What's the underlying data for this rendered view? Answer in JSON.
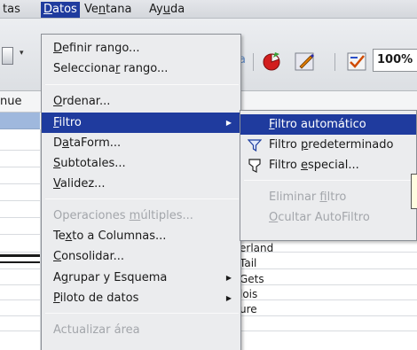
{
  "menubar": {
    "items": [
      {
        "label": "tas",
        "mnemonic": ""
      },
      {
        "label": "Datos",
        "mnemonic": "D"
      },
      {
        "label": "Ventana",
        "mnemonic": "n"
      },
      {
        "label": "Ayuda",
        "mnemonic": "u"
      }
    ],
    "active": "Datos"
  },
  "toolbar": {
    "zoom": "100%",
    "faint_text": "a"
  },
  "namebox": {
    "value": "nue"
  },
  "sheet": {
    "cells": [
      "erland",
      "Tail",
      "Gets",
      "lois",
      "ure"
    ]
  },
  "datos_menu": {
    "items": [
      {
        "label": "Definir rango...",
        "state": "normal"
      },
      {
        "label": "Seleccionar rango...",
        "state": "normal"
      },
      {
        "label": "Ordenar...",
        "state": "normal"
      },
      {
        "label": "Filtro",
        "state": "selected",
        "has_submenu": true
      },
      {
        "label": "DataForm...",
        "state": "normal"
      },
      {
        "label": "Subtotales...",
        "state": "normal"
      },
      {
        "label": "Validez...",
        "state": "normal"
      },
      {
        "label": "Operaciones múltiples...",
        "state": "disabled"
      },
      {
        "label": "Texto a Columnas...",
        "state": "normal"
      },
      {
        "label": "Consolidar...",
        "state": "normal"
      },
      {
        "label": "Agrupar y Esquema",
        "state": "normal",
        "has_submenu": true
      },
      {
        "label": "Piloto de datos",
        "state": "normal",
        "has_submenu": true
      },
      {
        "label": "Actualizar área",
        "state": "disabled"
      }
    ]
  },
  "filtro_submenu": {
    "items": [
      {
        "label": "Filtro automático",
        "state": "selected",
        "icon": ""
      },
      {
        "label": "Filtro predeterminado",
        "state": "normal",
        "icon": "funnel-icon"
      },
      {
        "label": "Filtro especial...",
        "state": "normal",
        "icon": "filter-special-icon"
      },
      {
        "label": "Eliminar filtro",
        "state": "disabled"
      },
      {
        "label": "Ocultar AutoFiltro",
        "state": "disabled"
      }
    ]
  },
  "colors": {
    "highlight": "#1f3b9e",
    "menu_bg": "#ebecee",
    "disabled_text": "#a3a6ab",
    "header_blue": "#9fb8dd"
  }
}
